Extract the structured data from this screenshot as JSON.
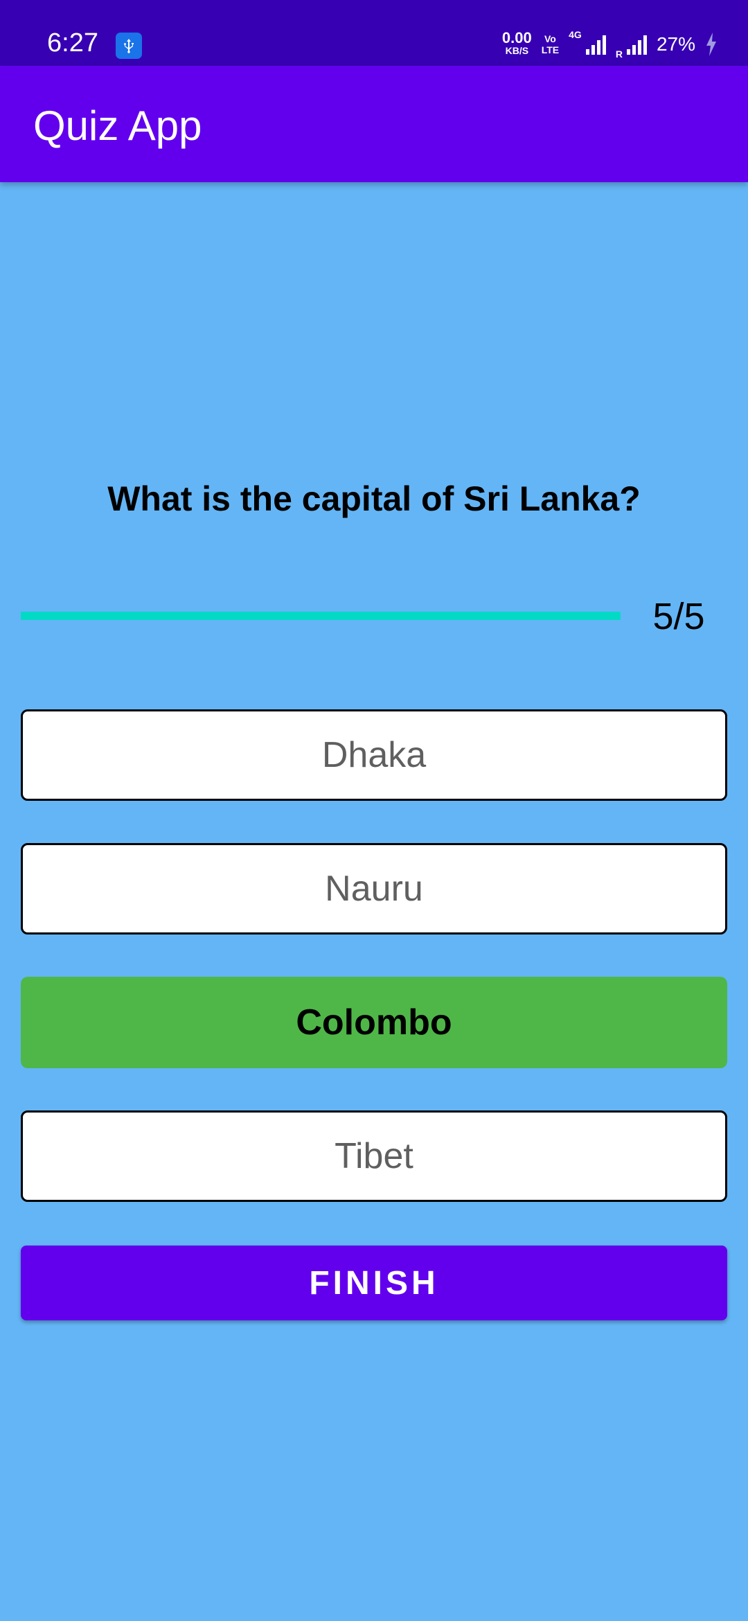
{
  "status_bar": {
    "time": "6:27",
    "usb_icon": "usb-icon",
    "net_speed_value": "0.00",
    "net_speed_unit": "KB/S",
    "volte_top": "Vo",
    "volte_bottom": "LTE",
    "network_type": "4G",
    "roaming_label": "R",
    "battery": "27%",
    "charging_icon": "lightning-icon"
  },
  "app_bar": {
    "title": "Quiz App"
  },
  "quiz": {
    "question": "What is the capital of Sri Lanka?",
    "progress_text": "5/5",
    "progress_fraction": 1.0,
    "options": [
      {
        "label": "Dhaka",
        "state": "default"
      },
      {
        "label": "Nauru",
        "state": "default"
      },
      {
        "label": "Colombo",
        "state": "correct"
      },
      {
        "label": "Tibet",
        "state": "default"
      }
    ],
    "submit_label": "FINISH"
  },
  "colors": {
    "background": "#64b5f6",
    "status_bar": "#3700b3",
    "app_bar": "#6200ee",
    "progress": "#03dac5",
    "correct": "#4fb748",
    "button": "#6200ee"
  }
}
